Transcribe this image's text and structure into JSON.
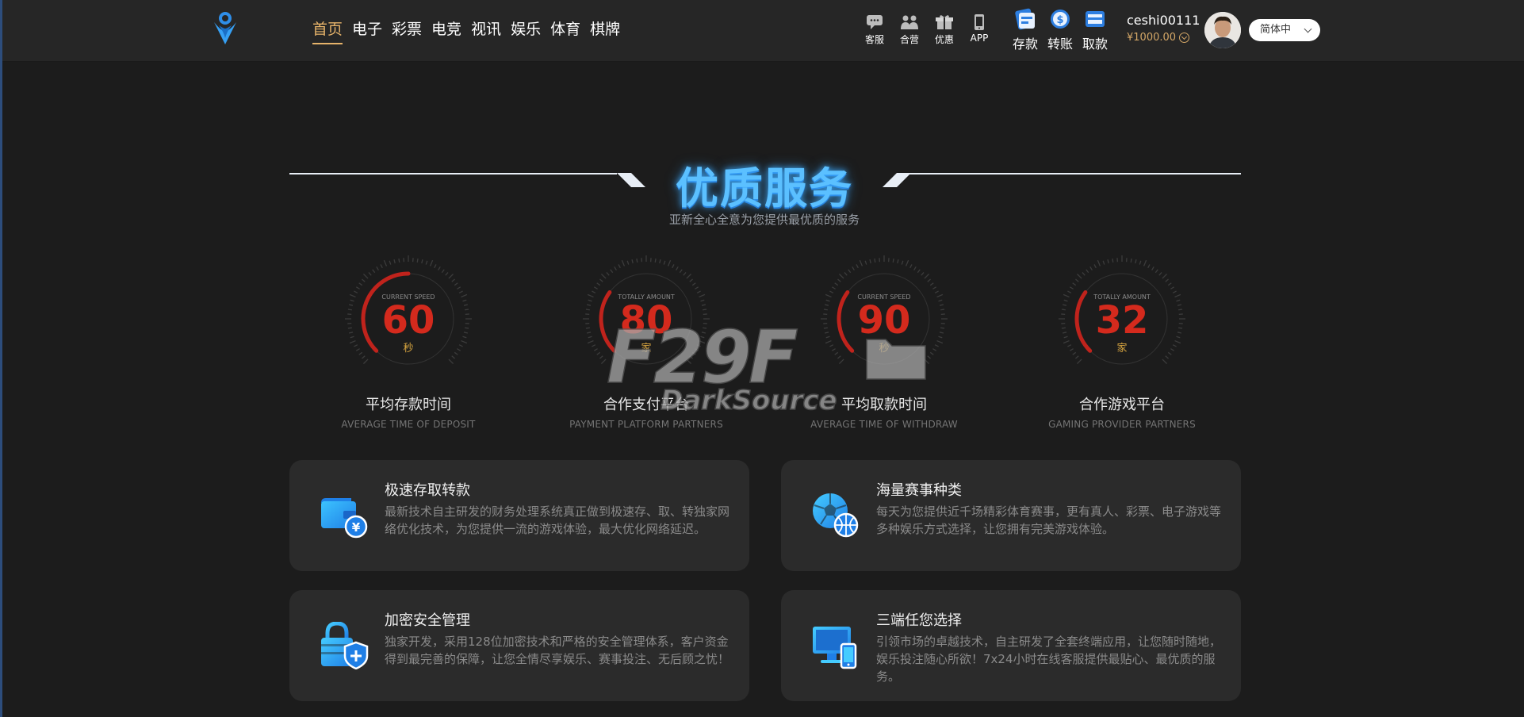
{
  "header": {
    "nav": [
      "首页",
      "电子",
      "彩票",
      "电竞",
      "视讯",
      "娱乐",
      "体育",
      "棋牌"
    ],
    "active_nav": "首页",
    "tools": [
      {
        "label": "客服",
        "icon": "chat-icon"
      },
      {
        "label": "合营",
        "icon": "partners-icon"
      },
      {
        "label": "优惠",
        "icon": "gift-icon"
      },
      {
        "label": "APP",
        "icon": "phone-icon"
      }
    ],
    "money": [
      {
        "label": "存款",
        "icon": "deposit-icon"
      },
      {
        "label": "转账",
        "icon": "transfer-icon"
      },
      {
        "label": "取款",
        "icon": "withdraw-icon"
      }
    ],
    "username": "ceshi00111",
    "balance": "¥1000.00",
    "language": "简体中"
  },
  "section": {
    "title": "优质服务",
    "subtitle": "亚新全心全意为您提供最优质的服务"
  },
  "stats": [
    {
      "caption": "CURRENT SPEED",
      "value": "60",
      "unit": "秒",
      "label": "平均存款时间",
      "en": "AVERAGE TIME OF DEPOSIT",
      "fill": 0.5
    },
    {
      "caption": "TOTALLY AMOUNT",
      "value": "80",
      "unit": "家",
      "label": "合作支付平台",
      "en": "PAYMENT PLATFORM PARTNERS",
      "fill": 0.3
    },
    {
      "caption": "CURRENT SPEED",
      "value": "90",
      "unit": "秒",
      "label": "平均取款时间",
      "en": "AVERAGE TIME OF WITHDRAW",
      "fill": 0.3
    },
    {
      "caption": "TOTALLY AMOUNT",
      "value": "32",
      "unit": "家",
      "label": "合作游戏平台",
      "en": "GAMING PROVIDER PARTNERS",
      "fill": 0.3
    }
  ],
  "watermark": {
    "brand": "F29F",
    "tagline": "DarkSource"
  },
  "features": [
    {
      "title": "极速存取转款",
      "desc": "最新技术自主研发的财务处理系统真正做到极速存、取、转独家网络优化技术，为您提供一流的游戏体验，最大优化网络延迟。",
      "icon": "wallet-icon"
    },
    {
      "title": "海量赛事种类",
      "desc": "每天为您提供近千场精彩体育赛事，更有真人、彩票、电子游戏等多种娱乐方式选择，让您拥有完美游戏体验。",
      "icon": "ball-icon"
    },
    {
      "title": "加密安全管理",
      "desc": "独家开发，采用128位加密技术和严格的安全管理体系，客户资金得到最完善的保障，让您全情尽享娱乐、赛事投注、无后顾之忧！",
      "icon": "lock-shield-icon"
    },
    {
      "title": "三端任您选择",
      "desc": "引领市场的卓越技术，自主研发了全套终端应用，让您随时随地，娱乐投注随心所欲！7x24小时在线客服提供最贴心、最优质的服务。",
      "icon": "devices-icon"
    }
  ]
}
